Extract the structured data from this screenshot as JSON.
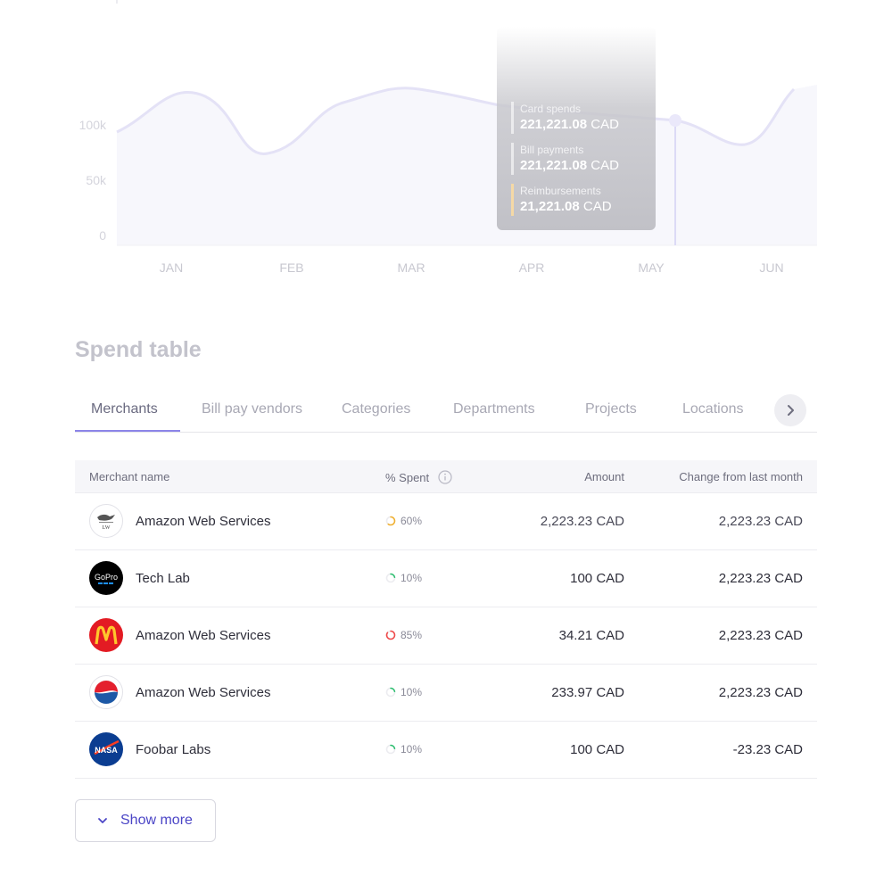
{
  "chart": {
    "y_ticks": [
      "100k",
      "50k",
      "0"
    ],
    "x_ticks": [
      "JAN",
      "FEB",
      "MAR",
      "APR",
      "MAY",
      "JUN"
    ],
    "colors": {
      "line": "#e4e2f6",
      "area": "#f7f7fc",
      "marker": "#dcdaf6"
    }
  },
  "tooltip": {
    "items": [
      {
        "label": "Card spends",
        "amount": "221,221.08",
        "currency": "CAD",
        "color": "#ffffff"
      },
      {
        "label": "Bill payments",
        "amount": "221,221.08",
        "currency": "CAD",
        "color": "#ffffff"
      },
      {
        "label": "Reimbursements",
        "amount": "21,221.08",
        "currency": "CAD",
        "color": "#f5d9a6"
      }
    ]
  },
  "section_title": "Spend table",
  "tabs": [
    "Merchants",
    "Bill pay vendors",
    "Categories",
    "Departments",
    "Projects",
    "Locations"
  ],
  "active_tab": "Merchants",
  "table": {
    "headers": {
      "merchant": "Merchant name",
      "spent": "% Spent",
      "amount": "Amount",
      "change": "Change from last month"
    },
    "rows": [
      {
        "logo": "dragon-logo-icon",
        "name": "Amazon Web Services",
        "pct": "60%",
        "pct_value": 60,
        "ring_color": "#f0b030",
        "amount": "2,223.23 CAD",
        "change": "2,223.23 CAD"
      },
      {
        "logo": "gopro-logo-icon",
        "name": "Tech Lab",
        "pct": "10%",
        "pct_value": 10,
        "ring_color": "#2fbf71",
        "amount": "100 CAD",
        "change": "2,223.23 CAD"
      },
      {
        "logo": "mcdonalds-logo-icon",
        "name": "Amazon Web Services",
        "pct": "85%",
        "pct_value": 85,
        "ring_color": "#ef4a4a",
        "amount": "34.21 CAD",
        "change": "2,223.23 CAD"
      },
      {
        "logo": "pepsi-logo-icon",
        "name": "Amazon Web Services",
        "pct": "10%",
        "pct_value": 10,
        "ring_color": "#2fbf71",
        "amount": "233.97 CAD",
        "change": "2,223.23 CAD"
      },
      {
        "logo": "nasa-logo-icon",
        "name": "Foobar Labs",
        "pct": "10%",
        "pct_value": 10,
        "ring_color": "#2fbf71",
        "amount": "100 CAD",
        "change": "-23.23 CAD"
      }
    ]
  },
  "show_more_label": "Show more"
}
